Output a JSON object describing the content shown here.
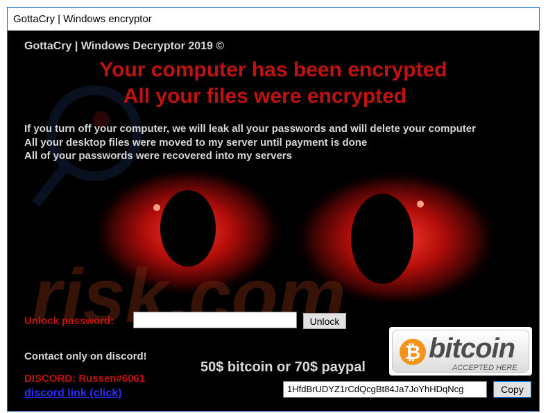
{
  "window": {
    "title": "GottaCry | Windows encryptor"
  },
  "app": {
    "title": "GottaCry | Windows Decryptor 2019 ©",
    "headline_line1": "Your computer has been encrypted",
    "headline_line2": "All your files were encrypted",
    "warnings": [
      "If you turn off your computer, we will leak all your passwords and will delete your computer",
      "All your desktop files were moved to my server until payment is done",
      "All of your passwords were recovered into my servers"
    ]
  },
  "unlock": {
    "label": "Unlock password:",
    "input_value": "",
    "button_label": "Unlock"
  },
  "contact": {
    "text": "Contact only on discord!",
    "discord_label": "DISCORD: Russen#6061",
    "link_text": "discord link (click)"
  },
  "payment": {
    "price_text": "50$ bitcoin or 70$ paypal",
    "badge_word": "bitcoin",
    "badge_subtitle": "ACCEPTED HERE",
    "badge_coin_symbol": "₿",
    "address": "1HfdBrUDYZ1rCdQcgBt84Ja7JoYhHDqNcg",
    "copy_label": "Copy"
  },
  "watermark": {
    "text": "risk.com"
  },
  "colors": {
    "accent_red": "#c0120f",
    "text_light": "#d9d9d9",
    "link_blue": "#2d2dff",
    "bitcoin_orange": "#f7931a",
    "window_border": "#1a6fc9"
  }
}
